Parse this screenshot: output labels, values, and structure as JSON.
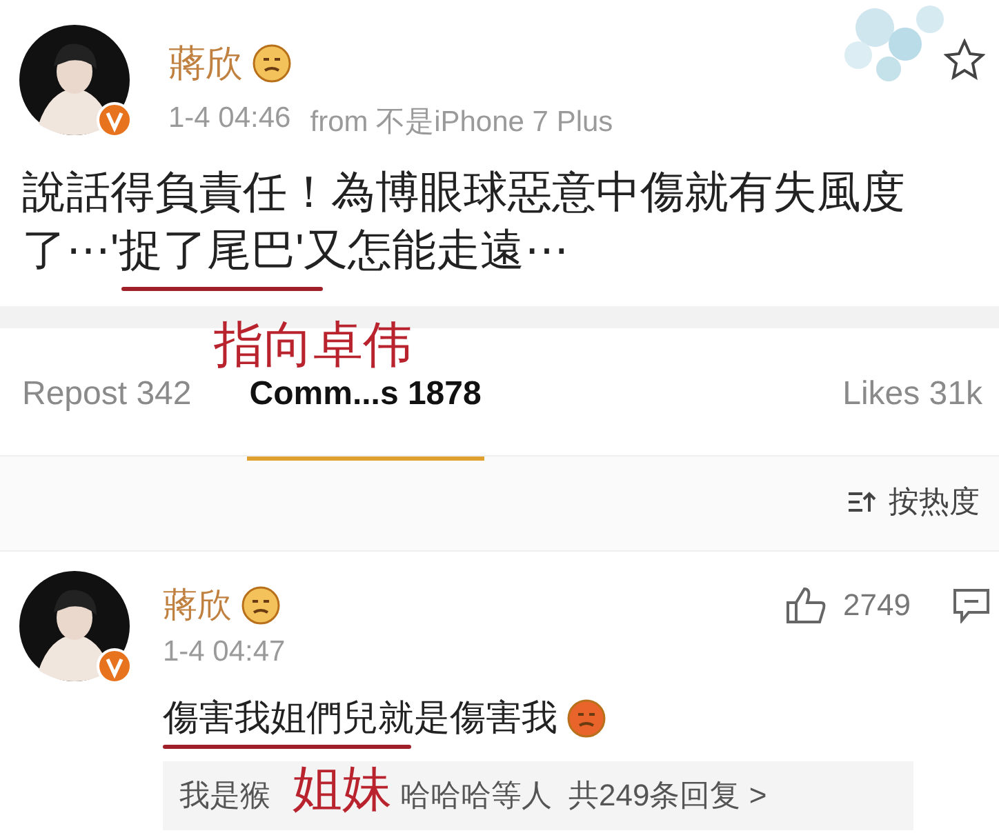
{
  "post": {
    "author": "蔣欣",
    "verified": true,
    "time": "1-4 04:46",
    "source": "from 不是iPhone 7 Plus",
    "text": "說話得負責任！為博眼球惡意中傷就有失風度了⋯'捉了尾巴'又怎能走遠⋯"
  },
  "tabs": [
    {
      "label": "Repost 342",
      "selected": false
    },
    {
      "label": "Comm...s 1878",
      "selected": true
    },
    {
      "label": "Likes 31k",
      "selected": false
    }
  ],
  "sort": {
    "label": "按热度"
  },
  "comment": {
    "author": "蔣欣",
    "verified": true,
    "time": "1-4 04:47",
    "text": "傷害我姐們兒就是傷害我",
    "likes": "2749",
    "reply_start": "我是猴",
    "reply_end": "哈哈哈等人",
    "reply_count": "共249条回复 >"
  },
  "annotations": [
    {
      "text": "指向卓伟"
    },
    {
      "text": "姐妹"
    }
  ]
}
